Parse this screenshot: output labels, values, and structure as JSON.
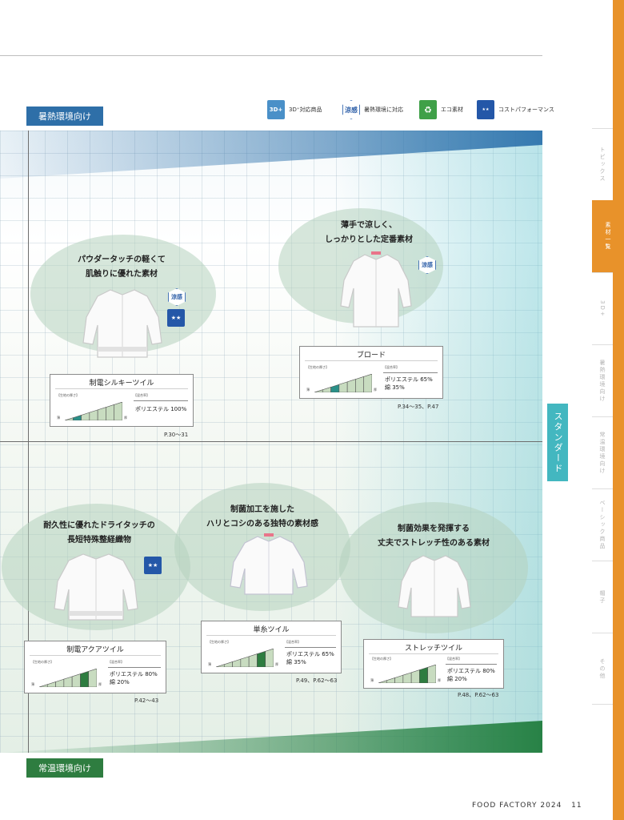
{
  "legend": [
    {
      "icon": "3d-plus-icon",
      "mark": "3D+",
      "label": "3D⁺対応商品"
    },
    {
      "icon": "cool-feel-icon",
      "mark": "涼感",
      "label": "暑熱環境に対応"
    },
    {
      "icon": "eco-material-icon",
      "mark": "♻",
      "label": "エコ素材"
    },
    {
      "icon": "cost-performance-icon",
      "mark": "★★",
      "label": "コストパフォーマンス"
    }
  ],
  "env": {
    "hot": "暑熱環境向け",
    "normal": "常温環境向け"
  },
  "standard_label": "スタンダード",
  "scale": {
    "thickness": "【生地の厚さ】",
    "mix": "【混合率】",
    "thin": "薄",
    "thick": "厚"
  },
  "cool_mark": "涼感",
  "cost_mark": "★★",
  "products": [
    {
      "catch": "パウダータッチの軽くて\n肌触りに優れた素材",
      "name": "制電シルキーツイル",
      "mix": "ポリエステル 100%",
      "pages": "P.30〜31",
      "thickness_level": 1
    },
    {
      "catch": "薄手で涼しく、\nしっかりとした定番素材",
      "name": "ブロード",
      "mix": "ポリエステル 65%\n綿 35%",
      "pages": "P.34〜35、P.47",
      "thickness_level": 2
    },
    {
      "catch": "耐久性に優れたドライタッチの\n長短特殊整経織物",
      "name": "制電アクアツイル",
      "mix": "ポリエステル 80%\n綿 20%",
      "pages": "P.42〜43",
      "thickness_level": 5
    },
    {
      "catch": "制菌加工を施した\nハリとコシのある独特の素材感",
      "name": "単糸ツイル",
      "mix": "ポリエステル 65%\n綿 35%",
      "pages": "P.49、P.62〜63",
      "thickness_level": 5
    },
    {
      "catch": "制菌効果を発揮する\n丈夫でストレッチ性のある素材",
      "name": "ストレッチツイル",
      "mix": "ポリエステル 80%\n綿 20%",
      "pages": "P.48、P.62〜63",
      "thickness_level": 5
    }
  ],
  "sidebar": [
    {
      "label": "トピックス",
      "active": false
    },
    {
      "label": "素材一覧",
      "active": true
    },
    {
      "label": "3D+",
      "active": false
    },
    {
      "label": "暑熱環境向け",
      "active": false
    },
    {
      "label": "常温環境向け",
      "active": false
    },
    {
      "label": "ベーシック商品",
      "active": false
    },
    {
      "label": "帽子",
      "active": false
    },
    {
      "label": "その他",
      "active": false
    }
  ],
  "footer": {
    "brand": "FOOD FACTORY 2024",
    "page": "11"
  },
  "colors": {
    "hot": "#2e6fa8",
    "normal": "#2e7d40",
    "standard": "#43b7c0",
    "sidebar": "#e8922a",
    "scale_fill": "#c8dcc0",
    "scale_accent_teal": "#2a9088",
    "scale_accent_green": "#2e7d40"
  }
}
